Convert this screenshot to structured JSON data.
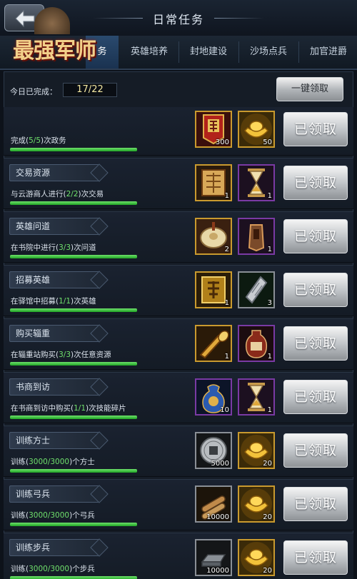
{
  "header": {
    "title": "日常任务",
    "logo_text": "最强军师"
  },
  "tabs": [
    {
      "label": "务",
      "active": true
    },
    {
      "label": "英雄培养"
    },
    {
      "label": "封地建设"
    },
    {
      "label": "沙场点兵"
    },
    {
      "label": "加官进爵"
    }
  ],
  "summary": {
    "label": "今日已完成：",
    "value": "17/22"
  },
  "claim_all_label": "一键领取",
  "colors": {
    "accent_green": "#6fe06c",
    "gold_border": "#c99a2e",
    "purple_border": "#7a3aa4"
  },
  "tasks": [
    {
      "name": "",
      "desc_pre": "完成(",
      "desc_hl": "5/5",
      "desc_post": ")次政务",
      "progress": 1.0,
      "rewards": [
        {
          "icon": "decree-icon",
          "count": "300"
        },
        {
          "icon": "gold-ingot-icon",
          "count": "50"
        }
      ],
      "claim_label": "已领取"
    },
    {
      "name": "交易资源",
      "desc_pre": "与云游商人进行(",
      "desc_hl": "2/2",
      "desc_post": ")次交易",
      "progress": 1.0,
      "rewards": [
        {
          "icon": "scroll-crate-icon",
          "count": "1"
        },
        {
          "icon": "hourglass-icon",
          "count": "1"
        }
      ],
      "claim_label": "已领取"
    },
    {
      "name": "英雄问道",
      "desc_pre": "在书院中进行(",
      "desc_hl": "3/3",
      "desc_post": ")次问道",
      "progress": 1.0,
      "rewards": [
        {
          "icon": "bread-icon",
          "count": "2"
        },
        {
          "icon": "token-icon",
          "count": "1"
        }
      ],
      "claim_label": "已领取"
    },
    {
      "name": "招募英雄",
      "desc_pre": "在驿馆中招募(",
      "desc_hl": "1/1",
      "desc_post": ")次英雄",
      "progress": 1.0,
      "rewards": [
        {
          "icon": "recruit-order-icon",
          "count": "1"
        },
        {
          "icon": "scroll-fragment-icon",
          "count": "3"
        }
      ],
      "claim_label": "已领取"
    },
    {
      "name": "购买辎重",
      "desc_pre": "在辎重站购买(",
      "desc_hl": "3/3",
      "desc_post": ")次任意资源",
      "progress": 1.0,
      "rewards": [
        {
          "icon": "horn-icon",
          "count": "1"
        },
        {
          "icon": "wine-jar-icon",
          "count": "1"
        }
      ],
      "claim_label": "已领取"
    },
    {
      "name": "书商到访",
      "desc_pre": "在书商到访中购买(",
      "desc_hl": "1/1",
      "desc_post": ")次技能碎片",
      "progress": 1.0,
      "rewards": [
        {
          "icon": "treasure-bag-icon",
          "count": "10"
        },
        {
          "icon": "hourglass-icon",
          "count": "1"
        }
      ],
      "claim_label": "已领取"
    },
    {
      "name": "训练方士",
      "desc_pre": "训练(",
      "desc_hl": "3000/3000",
      "desc_post": ")个方士",
      "progress": 1.0,
      "rewards": [
        {
          "icon": "silver-coin-icon",
          "count": "5000"
        },
        {
          "icon": "gold-ingot-icon",
          "count": "20"
        }
      ],
      "claim_label": "已领取"
    },
    {
      "name": "训练弓兵",
      "desc_pre": "训练(",
      "desc_hl": "3000/3000",
      "desc_post": ")个弓兵",
      "progress": 1.0,
      "rewards": [
        {
          "icon": "wood-logs-icon",
          "count": "10000"
        },
        {
          "icon": "gold-ingot-icon",
          "count": "20"
        }
      ],
      "claim_label": "已领取"
    },
    {
      "name": "训练步兵",
      "desc_pre": "训练(",
      "desc_hl": "3000/3000",
      "desc_post": ")个步兵",
      "progress": 1.0,
      "rewards": [
        {
          "icon": "iron-ingot-icon",
          "count": "10000"
        },
        {
          "icon": "gold-ingot-icon",
          "count": "20"
        }
      ],
      "claim_label": "已领取"
    }
  ]
}
